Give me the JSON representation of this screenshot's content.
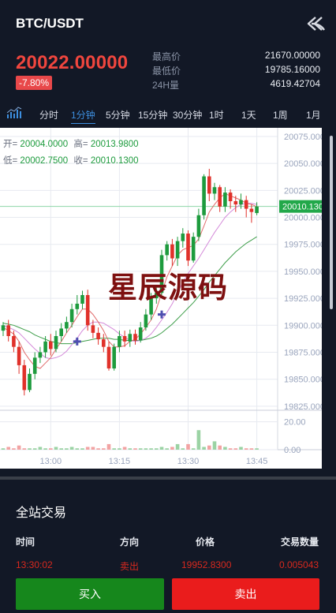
{
  "header": {
    "pair": "BTC/USDT",
    "back_icon": "double-arrow-back-icon"
  },
  "ticker": {
    "last_price": "20022.00000",
    "change": "-7.80%",
    "high_label": "最高价",
    "high_value": "21670.00000",
    "low_label": "最低价",
    "low_value": "19785.16000",
    "volume_label": "24H量",
    "volume_value": "4619.42704"
  },
  "intervals": {
    "items": [
      "分时",
      "1分钟",
      "5分钟",
      "15分钟",
      "30分钟",
      "1时",
      "1天",
      "1周",
      "1月"
    ],
    "active": "1分钟"
  },
  "chart": {
    "ohlc": {
      "open_label": "开=",
      "open": "20004.0000",
      "high_label": "高=",
      "high": "20013.9800",
      "low_label": "低=",
      "low": "20002.7500",
      "close_label": "收=",
      "close": "20010.1300"
    },
    "current_tag": "20010.1300",
    "watermark": "星辰源码",
    "colors": {
      "up": "#1d9b3d",
      "down": "#e0312a",
      "ma5": "#e06b6b",
      "ma10": "#d48ad9",
      "ma30": "#3e9e4a",
      "crosshair": "#4f4fb0",
      "grid": "#e7eaf0",
      "axis_text": "#9aa5bd"
    }
  },
  "chart_data": {
    "type": "candlestick",
    "price_axis": {
      "ticks": [
        "20075.0000",
        "20050.0000",
        "20025.0000",
        "20000.0000",
        "19975.0000",
        "19950.0000",
        "19925.0000",
        "19900.0000",
        "19875.0000",
        "19850.0000",
        "19825.0000"
      ],
      "range": [
        19822,
        20083
      ]
    },
    "volume_axis": {
      "ticks": [
        "20.00",
        "0.00"
      ],
      "range": [
        0,
        26
      ]
    },
    "time_ticks": [
      "13:00",
      "13:15",
      "13:30",
      "13:45"
    ],
    "candles": [
      [
        19895,
        19900,
        19890,
        19903
      ],
      [
        19900,
        19890,
        19885,
        19905
      ],
      [
        19890,
        19880,
        19875,
        19895
      ],
      [
        19880,
        19863,
        19855,
        19885
      ],
      [
        19863,
        19840,
        19835,
        19868
      ],
      [
        19840,
        19855,
        19838,
        19860
      ],
      [
        19855,
        19870,
        19850,
        19875
      ],
      [
        19870,
        19875,
        19865,
        19880
      ],
      [
        19875,
        19885,
        19870,
        19890
      ],
      [
        19885,
        19878,
        19872,
        19892
      ],
      [
        19878,
        19890,
        19875,
        19895
      ],
      [
        19890,
        19897,
        19885,
        19902
      ],
      [
        19897,
        19903,
        19893,
        19908
      ],
      [
        19903,
        19915,
        19898,
        19920
      ],
      [
        19915,
        19920,
        19910,
        19928
      ],
      [
        19920,
        19928,
        19915,
        19932
      ],
      [
        19928,
        19900,
        19895,
        19933
      ],
      [
        19900,
        19893,
        19888,
        19905
      ],
      [
        19893,
        19887,
        19882,
        19898
      ],
      [
        19887,
        19880,
        19875,
        19892
      ],
      [
        19880,
        19860,
        19858,
        19885
      ],
      [
        19860,
        19880,
        19858,
        19883
      ],
      [
        19880,
        19890,
        19875,
        19895
      ],
      [
        19890,
        19885,
        19880,
        19895
      ],
      [
        19885,
        19892,
        19880,
        19896
      ],
      [
        19892,
        19886,
        19882,
        19896
      ],
      [
        19886,
        19898,
        19884,
        19903
      ],
      [
        19898,
        19910,
        19895,
        19915
      ],
      [
        19910,
        19925,
        19905,
        19930
      ],
      [
        19925,
        19930,
        19920,
        19935
      ],
      [
        19930,
        19965,
        19928,
        19970
      ],
      [
        19965,
        19975,
        19960,
        19978
      ],
      [
        19975,
        19962,
        19955,
        19980
      ],
      [
        19962,
        19978,
        19955,
        19982
      ],
      [
        19978,
        19985,
        19972,
        19990
      ],
      [
        19985,
        19960,
        19955,
        19988
      ],
      [
        19960,
        19982,
        19958,
        19986
      ],
      [
        19982,
        20002,
        19978,
        20008
      ],
      [
        20002,
        20038,
        19998,
        20040
      ],
      [
        20038,
        20022,
        20015,
        20045
      ],
      [
        20022,
        20028,
        20016,
        20032
      ],
      [
        20028,
        20010,
        20005,
        20030
      ],
      [
        20010,
        20023,
        20005,
        20028
      ],
      [
        20023,
        20015,
        20008,
        20026
      ],
      [
        20015,
        20012,
        20005,
        20020
      ],
      [
        20012,
        20016,
        20008,
        20022
      ],
      [
        20016,
        20008,
        20000,
        20020
      ],
      [
        20008,
        20005,
        19995,
        20012
      ],
      [
        20004,
        20010,
        20002,
        20014
      ]
    ],
    "ma5": [
      19898,
      19895,
      19892,
      19885,
      19875,
      19868,
      19862,
      19860,
      19865,
      19870,
      19878,
      19885,
      19893,
      19900,
      19908,
      19915,
      19915,
      19910,
      19903,
      19895,
      19885,
      19880,
      19880,
      19881,
      19885,
      19887,
      19892,
      19898,
      19905,
      19915,
      19930,
      19945,
      19955,
      19965,
      19970,
      19972,
      19974,
      19980,
      19992,
      20005,
      20012,
      20018,
      20022,
      20020,
      20018,
      20016,
      20013,
      20012,
      20010
    ],
    "ma10": [
      19900,
      19898,
      19896,
      19893,
      19888,
      19883,
      19878,
      19874,
      19870,
      19869,
      19870,
      19872,
      19876,
      19882,
      19888,
      19895,
      19900,
      19903,
      19903,
      19902,
      19899,
      19896,
      19892,
      19889,
      19886,
      19885,
      19886,
      19888,
      19892,
      19898,
      19905,
      19912,
      19920,
      19930,
      19940,
      19948,
      19955,
      19962,
      19970,
      19978,
      19986,
      19993,
      20000,
      20005,
      20009,
      20012,
      20013,
      20013,
      20012
    ],
    "ma30": [
      19902,
      19901,
      19900,
      19898,
      19896,
      19894,
      19891,
      19889,
      19887,
      19885,
      19884,
      19883,
      19883,
      19883,
      19884,
      19885,
      19886,
      19887,
      19888,
      19888,
      19888,
      19887,
      19887,
      19886,
      19886,
      19886,
      19886,
      19887,
      19888,
      19890,
      19893,
      19897,
      19901,
      19906,
      19911,
      19916,
      19921,
      19927,
      19933,
      19940,
      19946,
      19952,
      19958,
      19963,
      19968,
      19972,
      19976,
      19979,
      19982
    ],
    "volumes": [
      1,
      2,
      1,
      3,
      1,
      1,
      1,
      2,
      1,
      1,
      2,
      1,
      1,
      2,
      1,
      1,
      2,
      2,
      1,
      1,
      4,
      1,
      1,
      2,
      1,
      1,
      1,
      1,
      1,
      1,
      2,
      1,
      2,
      4,
      1,
      4,
      1,
      14,
      2,
      3,
      6,
      3,
      2,
      1,
      1,
      2,
      1,
      1,
      1
    ],
    "markers": [
      {
        "index": 14,
        "value": 19885
      },
      {
        "index": 30,
        "value": 19910
      }
    ],
    "current_price": 20010.13
  },
  "trades": {
    "title": "全站交易",
    "headers": {
      "time": "时间",
      "side": "方向",
      "price": "价格",
      "amount": "交易数量"
    },
    "rows": [
      {
        "time": "13:30:02",
        "side": "卖出",
        "price": "19952.8300",
        "amount": "0.005043"
      }
    ]
  },
  "actions": {
    "buy": "买入",
    "sell": "卖出"
  }
}
